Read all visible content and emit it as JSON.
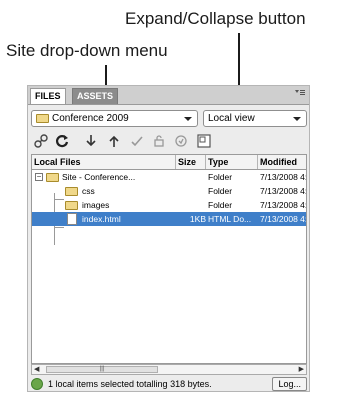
{
  "callouts": {
    "expand_collapse": "Expand/Collapse button",
    "site_menu": "Site drop-down menu"
  },
  "tabs": [
    "FILES",
    "ASSETS"
  ],
  "site_dropdown": "Conference 2009",
  "view_dropdown": "Local view",
  "toolbar_icons": [
    "connect-icon",
    "refresh-icon",
    "get-files-icon",
    "put-files-icon",
    "check-out-icon",
    "check-in-icon",
    "sync-icon",
    "expand-collapse-icon"
  ],
  "columns": [
    "Local Files",
    "Size",
    "Type",
    "Modified"
  ],
  "rows": [
    {
      "name": "Site - Conference...",
      "size": "",
      "type": "Folder",
      "modified": "7/13/2008 4:1"
    },
    {
      "name": "css",
      "size": "",
      "type": "Folder",
      "modified": "7/13/2008 4:1"
    },
    {
      "name": "images",
      "size": "",
      "type": "Folder",
      "modified": "7/13/2008 4:1"
    },
    {
      "name": "index.html",
      "size": "1KB",
      "type": "HTML Do...",
      "modified": "7/13/2008 4:"
    }
  ],
  "status": {
    "text": "1 local items selected totalling 318 bytes.",
    "log_button": "Log..."
  },
  "colors": {
    "selection": "#3f7fc9",
    "folder": "#f0d88a"
  }
}
